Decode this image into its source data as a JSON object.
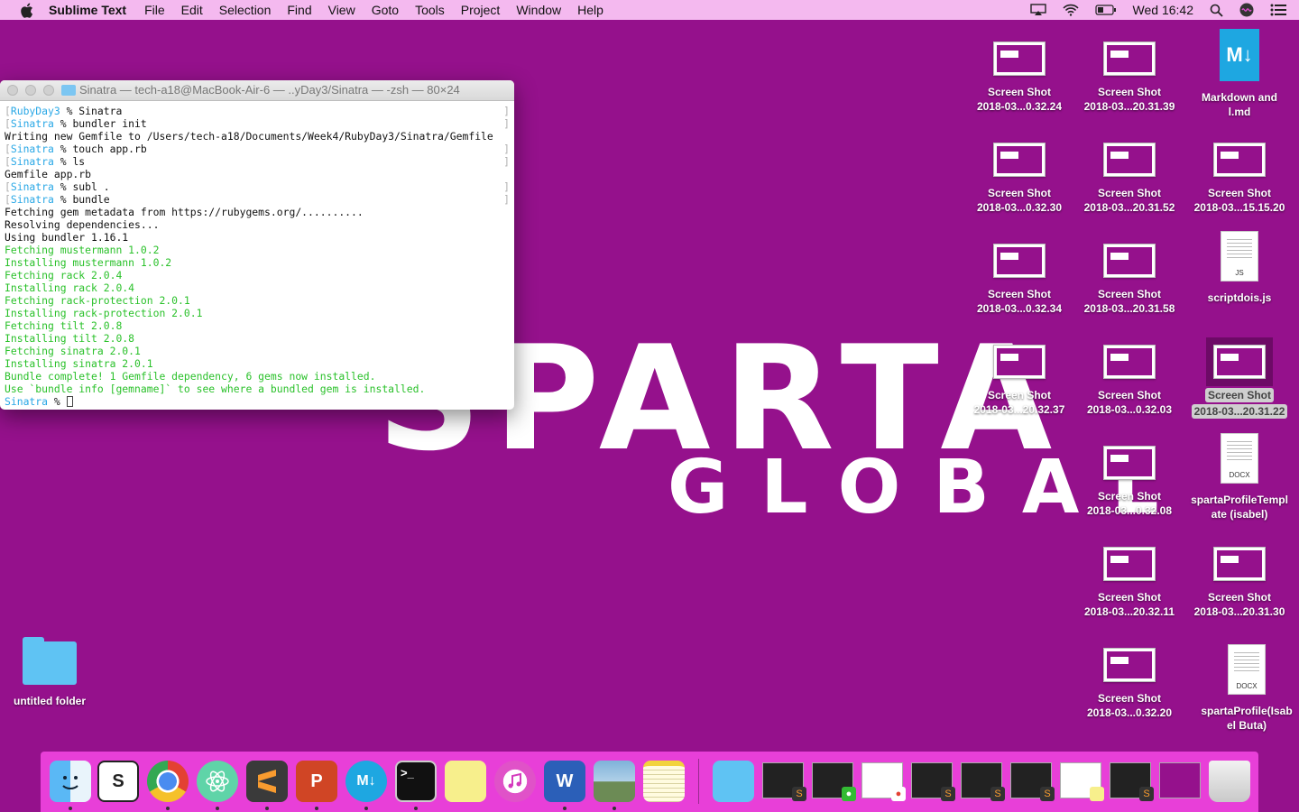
{
  "menubar": {
    "app_name": "Sublime Text",
    "items": [
      "File",
      "Edit",
      "Selection",
      "Find",
      "View",
      "Goto",
      "Tools",
      "Project",
      "Window",
      "Help"
    ],
    "clock": "Wed 16:42"
  },
  "wallpaper": {
    "line1": "SPARTA",
    "line2": "GLOBAL"
  },
  "terminal": {
    "title": "Sinatra — tech-a18@MacBook-Air-6 — ..yDay3/Sinatra — -zsh — 80×24",
    "lines": [
      {
        "type": "prompt",
        "dir": "RubyDay3",
        "cmd": "% Sinatra"
      },
      {
        "type": "prompt",
        "dir": "Sinatra",
        "cmd": "% bundler init"
      },
      {
        "type": "out",
        "text": "Writing new Gemfile to /Users/tech-a18/Documents/Week4/RubyDay3/Sinatra/Gemfile"
      },
      {
        "type": "prompt",
        "dir": "Sinatra",
        "cmd": "% touch app.rb"
      },
      {
        "type": "prompt",
        "dir": "Sinatra",
        "cmd": "% ls"
      },
      {
        "type": "out",
        "text": "Gemfile app.rb"
      },
      {
        "type": "prompt",
        "dir": "Sinatra",
        "cmd": "% subl ."
      },
      {
        "type": "prompt",
        "dir": "Sinatra",
        "cmd": "% bundle"
      },
      {
        "type": "out",
        "text": "Fetching gem metadata from https://rubygems.org/.........."
      },
      {
        "type": "out",
        "text": "Resolving dependencies..."
      },
      {
        "type": "out",
        "text": "Using bundler 1.16.1"
      },
      {
        "type": "green",
        "text": "Fetching mustermann 1.0.2"
      },
      {
        "type": "green",
        "text": "Installing mustermann 1.0.2"
      },
      {
        "type": "green",
        "text": "Fetching rack 2.0.4"
      },
      {
        "type": "green",
        "text": "Installing rack 2.0.4"
      },
      {
        "type": "green",
        "text": "Fetching rack-protection 2.0.1"
      },
      {
        "type": "green",
        "text": "Installing rack-protection 2.0.1"
      },
      {
        "type": "green",
        "text": "Fetching tilt 2.0.8"
      },
      {
        "type": "green",
        "text": "Installing tilt 2.0.8"
      },
      {
        "type": "green",
        "text": "Fetching sinatra 2.0.1"
      },
      {
        "type": "green",
        "text": "Installing sinatra 2.0.1"
      },
      {
        "type": "green",
        "text": "Bundle complete! 1 Gemfile dependency, 6 gems now installed."
      },
      {
        "type": "green",
        "text": "Use `bundle info [gemname]` to see where a bundled gem is installed."
      },
      {
        "type": "current",
        "dir": "Sinatra",
        "cmd": "% "
      }
    ]
  },
  "desktop": {
    "icons": [
      {
        "kind": "shot",
        "l1": "Screen Shot",
        "l2": "2018-03...0.32.24"
      },
      {
        "kind": "shot",
        "l1": "Screen Shot",
        "l2": "2018-03...20.31.39"
      },
      {
        "kind": "md",
        "l1": "Markdown and",
        "l2": "l.md",
        "icon_text": "M↓"
      },
      {
        "kind": "shot",
        "l1": "Screen Shot",
        "l2": "2018-03...0.32.30"
      },
      {
        "kind": "shot",
        "l1": "Screen Shot",
        "l2": "2018-03...20.31.52"
      },
      {
        "kind": "shot",
        "l1": "Screen Shot",
        "l2": "2018-03...15.15.20"
      },
      {
        "kind": "shot",
        "l1": "Screen Shot",
        "l2": "2018-03...0.32.34"
      },
      {
        "kind": "shot",
        "l1": "Screen Shot",
        "l2": "2018-03...20.31.58"
      },
      {
        "kind": "js",
        "l1": "scriptdois.js",
        "l2": "",
        "tag": "JS"
      },
      {
        "kind": "shot",
        "l1": "Screen Shot",
        "l2": "2018-03...20.32.37"
      },
      {
        "kind": "shot",
        "l1": "Screen Shot",
        "l2": "2018-03...0.32.03"
      },
      {
        "kind": "shot",
        "l1": "Screen Shot",
        "l2": "2018-03...20.31.22",
        "selected": true
      },
      {
        "kind": "shot",
        "l1": "Screen Shot",
        "l2": "2018-03...0.32.08"
      },
      {
        "kind": "docx",
        "l1": "spartaProfileTempl",
        "l2": "ate (isabel)",
        "tag": "DOCX"
      },
      {
        "kind": "shot",
        "l1": "Screen Shot",
        "l2": "2018-03...20.32.11"
      },
      {
        "kind": "shot",
        "l1": "Screen Shot",
        "l2": "2018-03...20.31.30"
      },
      {
        "kind": "shot",
        "l1": "Screen Shot",
        "l2": "2018-03...0.32.20"
      },
      {
        "kind": "docx",
        "l1": "spartaProfile(Isab",
        "l2": "el Buta)",
        "tag": "DOCX"
      },
      {
        "kind": "folder",
        "l1": "untitled folder",
        "l2": ""
      }
    ]
  },
  "dock": {
    "apps": [
      "finder-icon",
      "sublime-merge-icon",
      "chrome-icon",
      "atom-icon",
      "sublime-text-icon",
      "powerpoint-icon",
      "markdown-icon",
      "terminal-icon",
      "stickies-icon",
      "itunes-icon",
      "word-icon",
      "preview-icon",
      "notes-icon"
    ],
    "app_glyphs": {
      "powerpoint": "P",
      "markdown": "M↓",
      "terminal": ">_",
      "word": "W"
    },
    "trash": "trash-icon"
  }
}
